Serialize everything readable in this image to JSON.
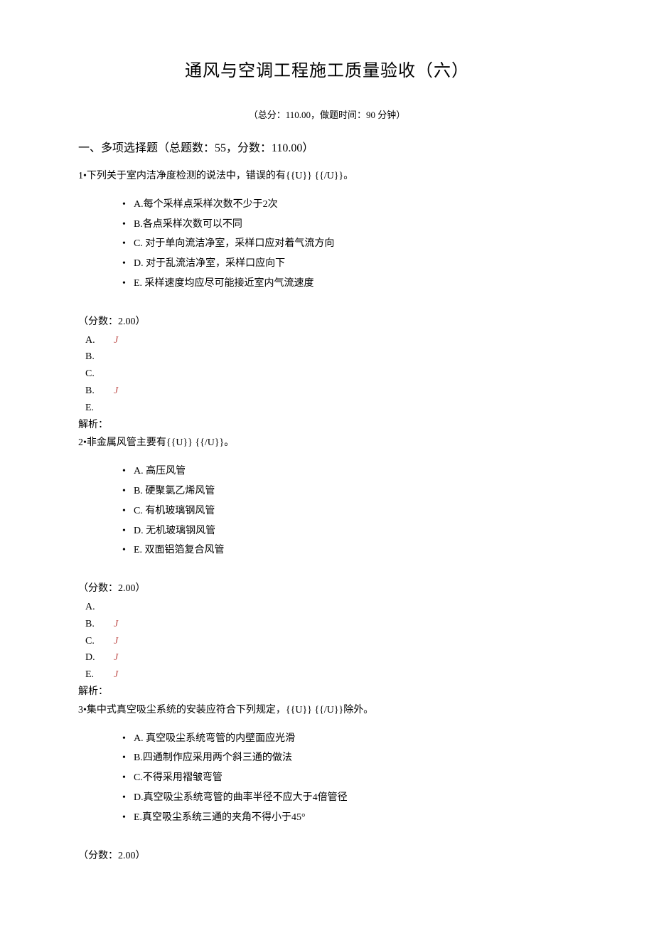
{
  "title": "通风与空调工程施工质量验收（六）",
  "summary": "（总分：110.00，做题时间：90 分钟）",
  "section_heading": "一、多项选择题（总题数：55，分数：110.00）",
  "mark_char": "J",
  "score_label": "（分数：2.00）",
  "analysis_label": "解析：",
  "questions": [
    {
      "num": "1",
      "stem": "下列关于室内洁净度检测的说法中，错误的有{{U}} {{/U}}。",
      "options": [
        "A.每个采样点采样次数不少于2次",
        "B.各点采样次数可以不同",
        "C. 对于单向流洁净室，采样口应对着气流方向",
        "D. 对于乱流洁净室，采样口应向下",
        "E. 采样速度均应尽可能接近室内气流速度"
      ],
      "answers": [
        {
          "letter": "A.",
          "marked": true
        },
        {
          "letter": "B.",
          "marked": false
        },
        {
          "letter": "C.",
          "marked": false
        },
        {
          "letter": "B.",
          "marked": true
        },
        {
          "letter": "E.",
          "marked": false
        }
      ]
    },
    {
      "num": "2",
      "stem": "非金属风管主要有{{U}} {{/U}}。",
      "options": [
        "A. 高压风管",
        "B. 硬聚氯乙烯风管",
        "C. 有机玻璃钢风管",
        "D. 无机玻璃钢风管",
        "E. 双面铝箔复合风管"
      ],
      "answers": [
        {
          "letter": "A.",
          "marked": false
        },
        {
          "letter": "B.",
          "marked": true
        },
        {
          "letter": "C.",
          "marked": true
        },
        {
          "letter": "D.",
          "marked": true
        },
        {
          "letter": "E.",
          "marked": true
        }
      ]
    },
    {
      "num": "3",
      "stem": "集中式真空吸尘系统的安装应符合下列规定，{{U}} {{/U}}除外。",
      "options": [
        "A. 真空吸尘系统弯管的内壁面应光滑",
        "B.四通制作应采用两个斜三通的做法",
        "C.不得采用褶皱弯管",
        "D.真空吸尘系统弯管的曲率半径不应大于4倍管径",
        "E.真空吸尘系统三通的夹角不得小于45°"
      ],
      "answers": [],
      "trailing_score_only": true
    }
  ]
}
